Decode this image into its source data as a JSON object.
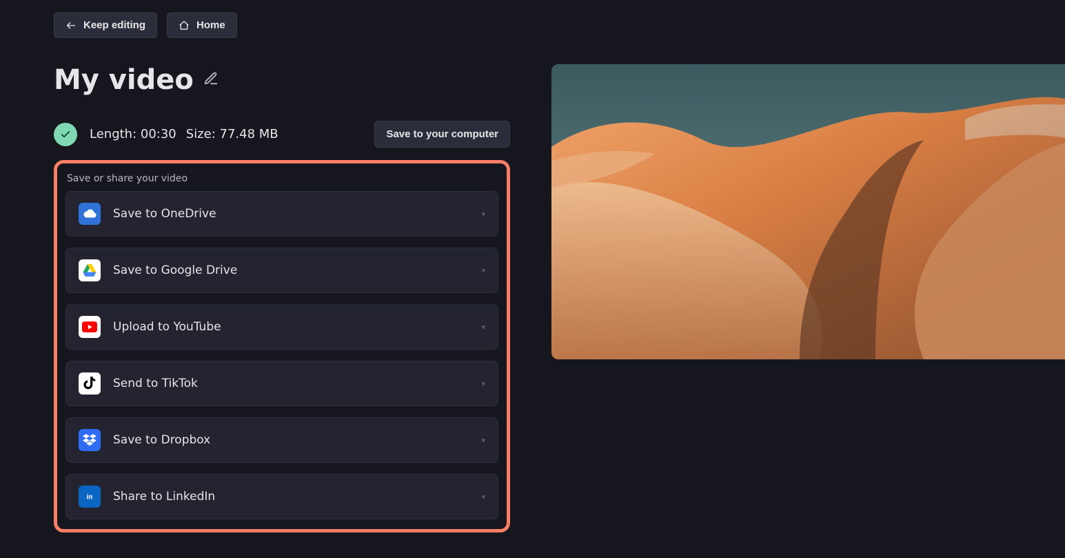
{
  "nav": {
    "keep_editing": "Keep editing",
    "home": "Home"
  },
  "title": "My video",
  "status": {
    "length_label": "Length:",
    "length_value": "00:30",
    "size_label": "Size:",
    "size_value": "77.48 MB"
  },
  "save_to_computer": "Save to your computer",
  "share_panel": {
    "heading": "Save or share your video",
    "items": [
      {
        "id": "onedrive",
        "label": "Save to OneDrive",
        "icon": "onedrive-icon"
      },
      {
        "id": "google-drive",
        "label": "Save to Google Drive",
        "icon": "google-drive-icon"
      },
      {
        "id": "youtube",
        "label": "Upload to YouTube",
        "icon": "youtube-icon"
      },
      {
        "id": "tiktok",
        "label": "Send to TikTok",
        "icon": "tiktok-icon"
      },
      {
        "id": "dropbox",
        "label": "Save to Dropbox",
        "icon": "dropbox-icon"
      },
      {
        "id": "linkedin",
        "label": "Share to LinkedIn",
        "icon": "linkedin-icon"
      }
    ]
  }
}
